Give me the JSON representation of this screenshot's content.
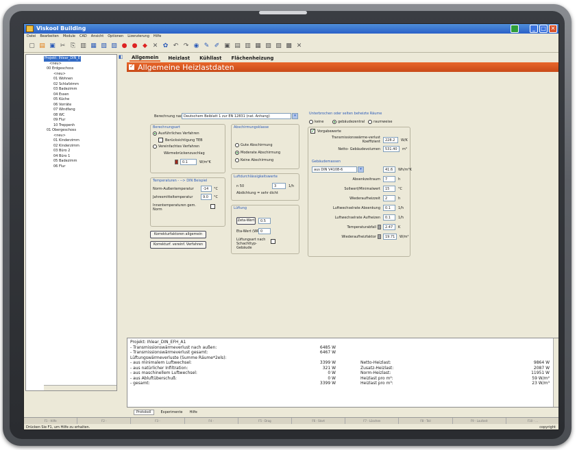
{
  "app": {
    "title": "Viskool Building"
  },
  "menu": [
    "Datei",
    "Bearbeiten",
    "Module",
    "CAD",
    "Ansicht",
    "Optionen",
    "Lizenzierung",
    "Hilfe"
  ],
  "tree": {
    "items": [
      "Projekt: Ihlear_DIN_E",
      "<neu>",
      "00 Erdgeschoss",
      "<neu>",
      "01 Wohnen",
      "02 Schlafzimm",
      "03 Badezimm",
      "04 Essen",
      "05 Küche",
      "06 Vorräte",
      "07 Windfang",
      "08 WC",
      "09 Flur",
      "10 Treppenh",
      "01 Obergeschoss",
      "<neu>",
      "01 Kinderzimm",
      "02 Kinderzimm",
      "03 Büro 2",
      "04 Büro 1",
      "05 Badezimm",
      "06 Flur"
    ]
  },
  "tabs": [
    "Allgemein",
    "Heizlast",
    "Kühllast",
    "Flächenheizung"
  ],
  "heading": "Allgemeine Heizlastdaten",
  "form": {
    "berechnung_label": "Berechnung nach",
    "berechnung_value": "Deutschem Beiblatt 1 zur EN 12831 (nat. Anhang)",
    "berechnungsart_title": "Berechnungsart",
    "ausfuehrlich": "Ausführliches Verfahren",
    "teb": "Berücksichtigung TEB",
    "vereinfacht": "Vereinfachtes Verfahren",
    "waermebruecken": "Wärmebrückenzuschlag",
    "waermebruecken_value": "0.1",
    "waermebruecken_unit": "W/m²K",
    "abschirmung_title": "Abschirmungsklasse",
    "gute": "Gute Abschirmung",
    "moderate": "Moderate Abschirmung",
    "keine_abschirmung": "Keine Abschirmung",
    "temperaturen_title": "Temperaturen - --> DIN Beispiel",
    "norm_aussen": "Norm-Außentemperatur",
    "norm_aussen_value": "-14",
    "jahresmittel": "Jahresmitteltemperatur",
    "jahresmittel_value": "9.0",
    "temp_unit": "°C",
    "innentemp": "Innentemperaturen gem. Norm",
    "luftdicht_title": "Luftdurchlässigkeitswerte",
    "n50": "n 50",
    "n50_value": "3",
    "n50_unit": "1/h",
    "abdichtung": "Abdichtung = sehr dicht",
    "lueftung_title": "Lüftung",
    "zeta_btn": "Zeta-Wert",
    "zeta_value": "0.5",
    "eta": "Eta-Wert (WRG)",
    "eta_value": "0",
    "lueftungsart": "Lüftungsart nach Schachttyp-Gebäude",
    "korrektur1": "Korrekturfaktoren allgemein",
    "korrektur2": "Korrekturf. vereinf. Verfahren",
    "unterbrochen_title": "Unterbrochen oder selten beheizte Räume",
    "keine": "keine",
    "gebaeudezentral": "gebäudezentral",
    "raumweise": "raumweise",
    "vorgabewerte": "Vorgabewerte",
    "transmission_label": "Transmissionswärme-verlust Koeffizient",
    "transmission_value": "228.2",
    "transmission_unit": "W/K",
    "netto_label": "Netto- Gebäudevolumen",
    "netto_value": "531.40",
    "netto_unit": "m³",
    "gebaeudemasse_title": "Gebäudemassen",
    "gebaeudemasse_value": "aus DIN V4108-6",
    "gebaeudemasse_num": "41.6",
    "gebaeudemasse_unit": "Wh/m³K",
    "absenkzeitraum": "Absenkzeitraum",
    "absenkzeitraum_value": "7",
    "h_unit": "h",
    "sollwert": "Sollwert/Minimalwert",
    "sollwert_value": "15",
    "sollwert_unit": "°C",
    "wiederaufheizzeit": "Wiederaufheizzeit",
    "wiederaufheizzeit_value": "2",
    "luftwechsel_absenk": "Luftwechselrate Absenkung",
    "luftwechsel_absenk_value": "0.1",
    "luftwechsel_auf": "Luftwechselrate Aufheizen",
    "luftwechsel_auf_value": "0.1",
    "lw_unit": "1/h",
    "temperaturabfall": "Temperaturabfall",
    "temperaturabfall_value": "2.47",
    "temperaturabfall_unit": "K",
    "wiederaufheizfaktor": "Wiederaufheizfaktor",
    "wiederaufheizfaktor_value": "19.71",
    "wiederaufheizfaktor_unit": "W/m²"
  },
  "results": {
    "left_labels": [
      "Projekt: Ihlear_DIN_EFH_A1",
      "- Transmissionswärmeverlust nach außen:",
      "- Transmissionswärmeverlust gesamt:",
      "Lüftungswärmeverluste (Summe Räume*2els):",
      "- aus minimalem Luftwechsel:",
      "- aus natürlicher Infiltration:",
      "- aus maschinellem Luftwechsel:",
      "- aus Abluftüberschuß:",
      "- gesamt:"
    ],
    "left_values": [
      "",
      "6485 W",
      "6467 W",
      "",
      "3399 W",
      "321 W",
      "0 W",
      "0 W",
      "3399 W"
    ],
    "right_labels": [
      "",
      "",
      "",
      "",
      "Netto-Heizlast:",
      "Zusatz-Heizlast:",
      "Norm-Heizlast:",
      "Heizlast pro m²:",
      "Heizlast pro m³:"
    ],
    "right_values": [
      "",
      "",
      "",
      "",
      "9864 W",
      "2087 W",
      "11951 W",
      "59 W/m²",
      "23 W/m³"
    ]
  },
  "bottom_tabs": [
    "Protokoll",
    "Experimente",
    "Hilfe"
  ],
  "status": {
    "help": "Drücken Sie F1, um Hilfe zu erhalten.",
    "copyright": "copyright",
    "cells": [
      "F1 - Hilfe",
      "F2 -",
      "F3 -",
      "F4 -",
      "F5 - Drag",
      "F6 - Start",
      "F7 - Löschen",
      "F8 - Teil",
      "F9 - Laufzeit",
      "F10 - ..."
    ]
  }
}
